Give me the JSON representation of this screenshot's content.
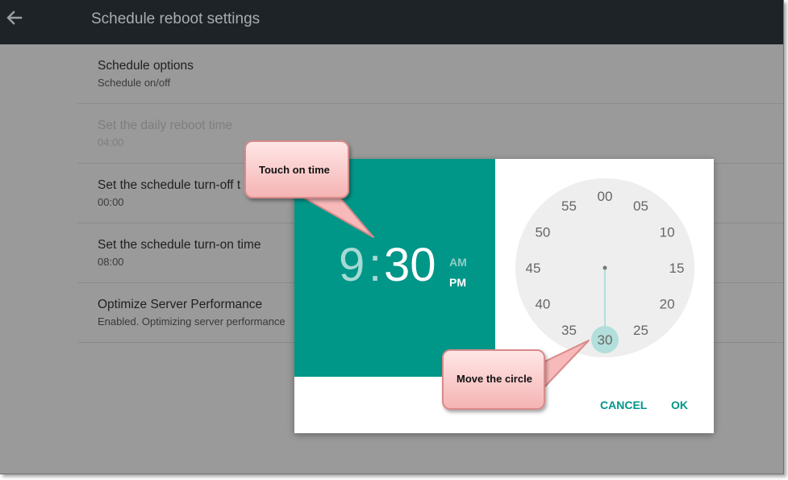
{
  "app": {
    "title": "Schedule reboot settings"
  },
  "settings": [
    {
      "title": "Schedule options",
      "subtitle": "Schedule on/off"
    },
    {
      "title": "Set the daily reboot time",
      "subtitle": "04:00"
    },
    {
      "title": "Set the schedule turn-off t",
      "subtitle": "00:00"
    },
    {
      "title": "Set the schedule turn-on time",
      "subtitle": "08:00"
    },
    {
      "title": "Optimize Server Performance",
      "subtitle": "Enabled. Optimizing server performance"
    }
  ],
  "dialog": {
    "hour": "9",
    "colon": ":",
    "minute": "30",
    "am": "AM",
    "pm": "PM",
    "cancel_label": "CANCEL",
    "ok_label": "OK",
    "clock": {
      "labels": [
        "00",
        "05",
        "10",
        "15",
        "20",
        "25",
        "30",
        "35",
        "40",
        "45",
        "50",
        "55"
      ],
      "selected_minute": "30"
    }
  },
  "callouts": {
    "touch": "Touch on time",
    "move": "Move the circle"
  },
  "colors": {
    "accent": "#009688",
    "toolbar": "#1d2326",
    "scrim": "#9a9a9a",
    "clock_face": "#eeeeee",
    "selector": "#b2dfdb",
    "callout": "#f8c4c4"
  },
  "icons": {
    "back": "arrow-left-icon"
  }
}
